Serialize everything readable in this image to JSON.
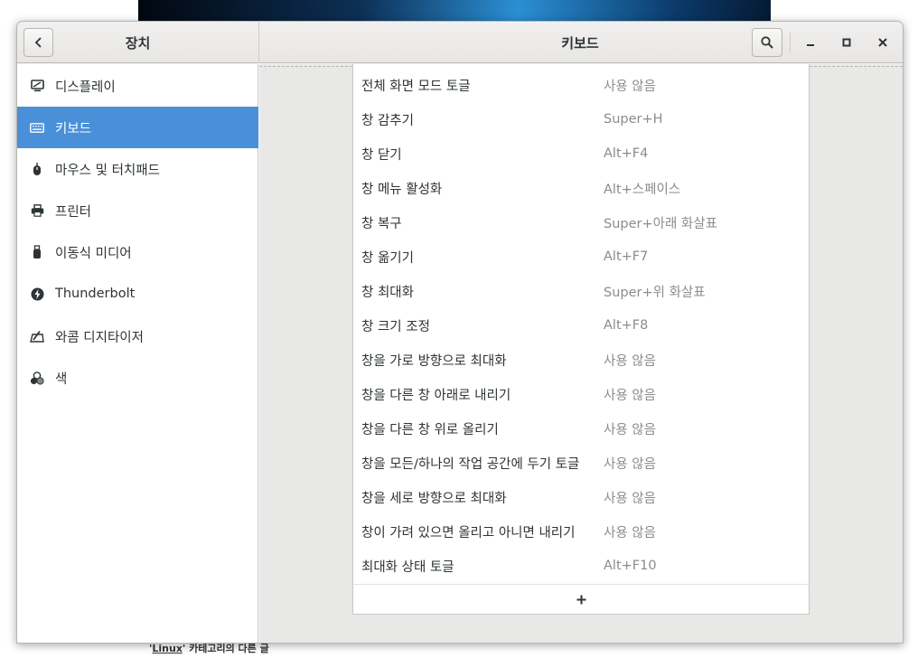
{
  "background": {
    "note_quote_open": "'",
    "note_link": "Linux",
    "note_rest": "' 카테고리의 다른 글"
  },
  "window": {
    "left_title": "장치",
    "main_title": "키보드",
    "icons": {
      "back": "chevron-left-icon",
      "search": "search-icon",
      "minimize": "minimize-icon",
      "maximize": "maximize-icon",
      "close": "close-icon"
    }
  },
  "sidebar": {
    "items": [
      {
        "label": "디스플레이",
        "icon": "display-icon"
      },
      {
        "label": "키보드",
        "icon": "keyboard-icon",
        "active": true
      },
      {
        "label": "마우스 및 터치패드",
        "icon": "mouse-icon"
      },
      {
        "label": "프린터",
        "icon": "printer-icon"
      },
      {
        "label": "이동식 미디어",
        "icon": "removable-media-icon"
      },
      {
        "label": "Thunderbolt",
        "icon": "thunderbolt-icon"
      },
      {
        "label": "와콤 디지타이저",
        "icon": "tablet-icon"
      },
      {
        "label": "색",
        "icon": "color-icon"
      }
    ]
  },
  "shortcuts": [
    {
      "name": "전체 화면 모드 토글",
      "accel": "사용 않음"
    },
    {
      "name": "창 감추기",
      "accel": "Super+H"
    },
    {
      "name": "창 닫기",
      "accel": "Alt+F4"
    },
    {
      "name": "창 메뉴 활성화",
      "accel": "Alt+스페이스"
    },
    {
      "name": "창 복구",
      "accel": "Super+아래 화살표"
    },
    {
      "name": "창 옮기기",
      "accel": "Alt+F7"
    },
    {
      "name": "창 최대화",
      "accel": "Super+위 화살표"
    },
    {
      "name": "창 크기 조정",
      "accel": "Alt+F8"
    },
    {
      "name": "창을 가로 방향으로 최대화",
      "accel": "사용 않음"
    },
    {
      "name": "창을 다른 창 아래로 내리기",
      "accel": "사용 않음"
    },
    {
      "name": "창을 다른 창 위로 올리기",
      "accel": "사용 않음"
    },
    {
      "name": "창을 모든/하나의 작업 공간에 두기 토글",
      "accel": "사용 않음"
    },
    {
      "name": "창을 세로 방향으로 최대화",
      "accel": "사용 않음"
    },
    {
      "name": "창이 가려 있으면 올리고 아니면 내리기",
      "accel": "사용 않음"
    },
    {
      "name": "최대화 상태 토글",
      "accel": "Alt+F10"
    }
  ],
  "add_button": {
    "label": "+",
    "icon": "plus-icon"
  },
  "colors": {
    "accent": "#4a90d9",
    "accel_text": "#8a8d8c",
    "text": "#2e3436"
  }
}
